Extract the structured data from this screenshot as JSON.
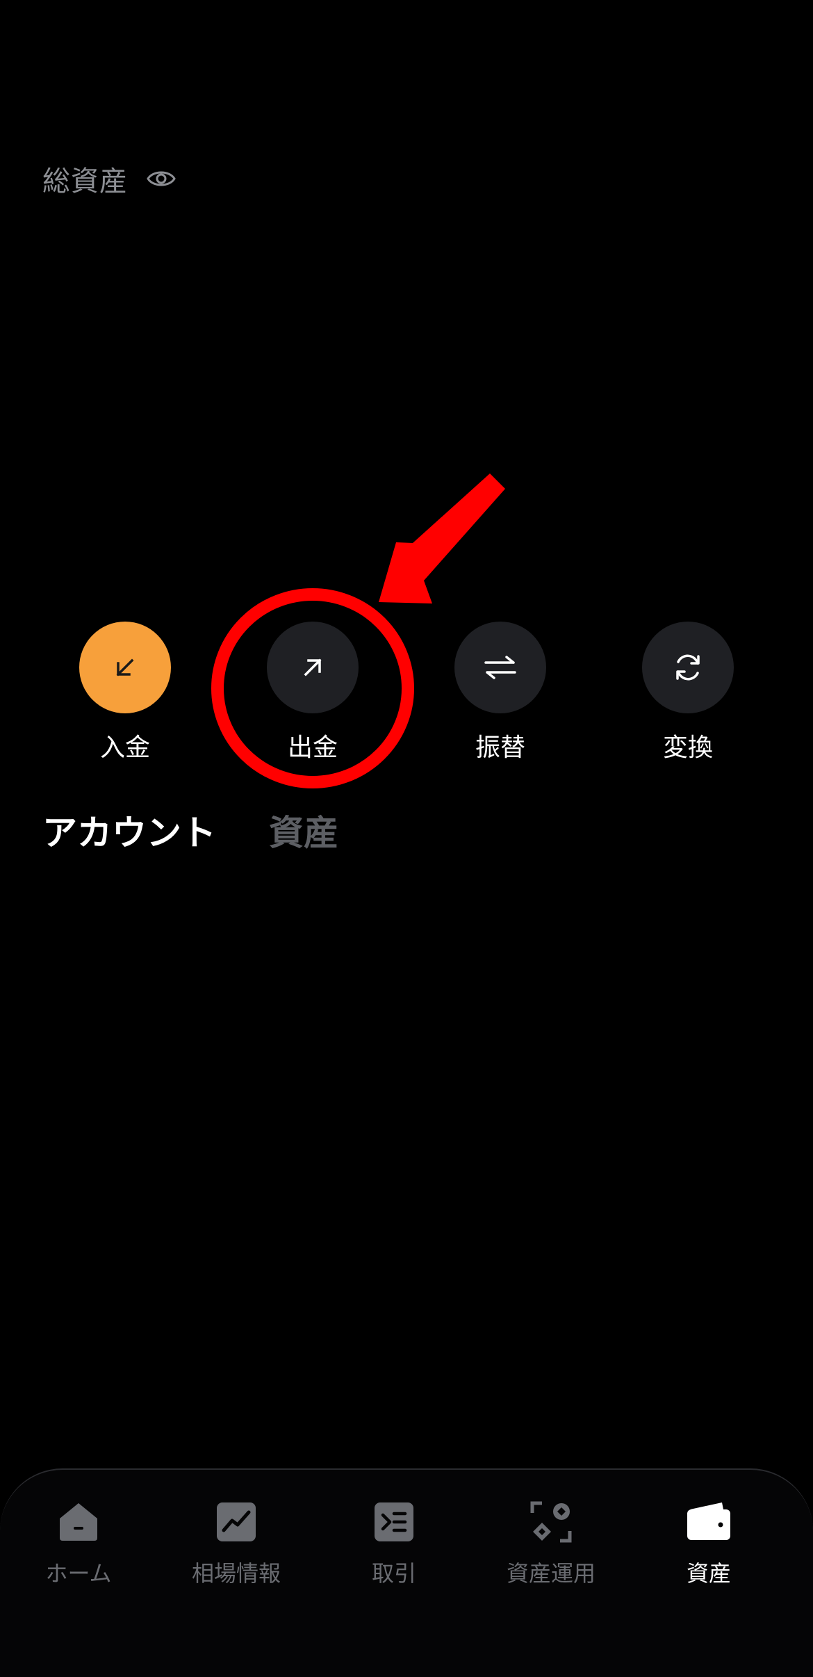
{
  "header": {
    "total_assets_label": "総資産"
  },
  "actions": [
    {
      "label": "入金",
      "icon": "arrow-down-left-icon"
    },
    {
      "label": "出金",
      "icon": "arrow-up-right-icon"
    },
    {
      "label": "振替",
      "icon": "swap-arrows-icon"
    },
    {
      "label": "変換",
      "icon": "refresh-icon"
    }
  ],
  "tabs": [
    {
      "label": "アカウント",
      "active": true
    },
    {
      "label": "資産",
      "active": false
    }
  ],
  "bottom_nav": [
    {
      "label": "ホーム",
      "icon": "home-icon",
      "active": false
    },
    {
      "label": "相場情報",
      "icon": "chart-icon",
      "active": false
    },
    {
      "label": "取引",
      "icon": "trade-icon",
      "active": false
    },
    {
      "label": "資産運用",
      "icon": "earn-icon",
      "active": false
    },
    {
      "label": "資産",
      "icon": "wallet-icon",
      "active": true
    }
  ],
  "colors": {
    "background": "#000000",
    "accent": "#f7a03b",
    "button_bg": "#1f2024",
    "muted_text": "#8d8f94",
    "annotation": "#ff0000"
  }
}
